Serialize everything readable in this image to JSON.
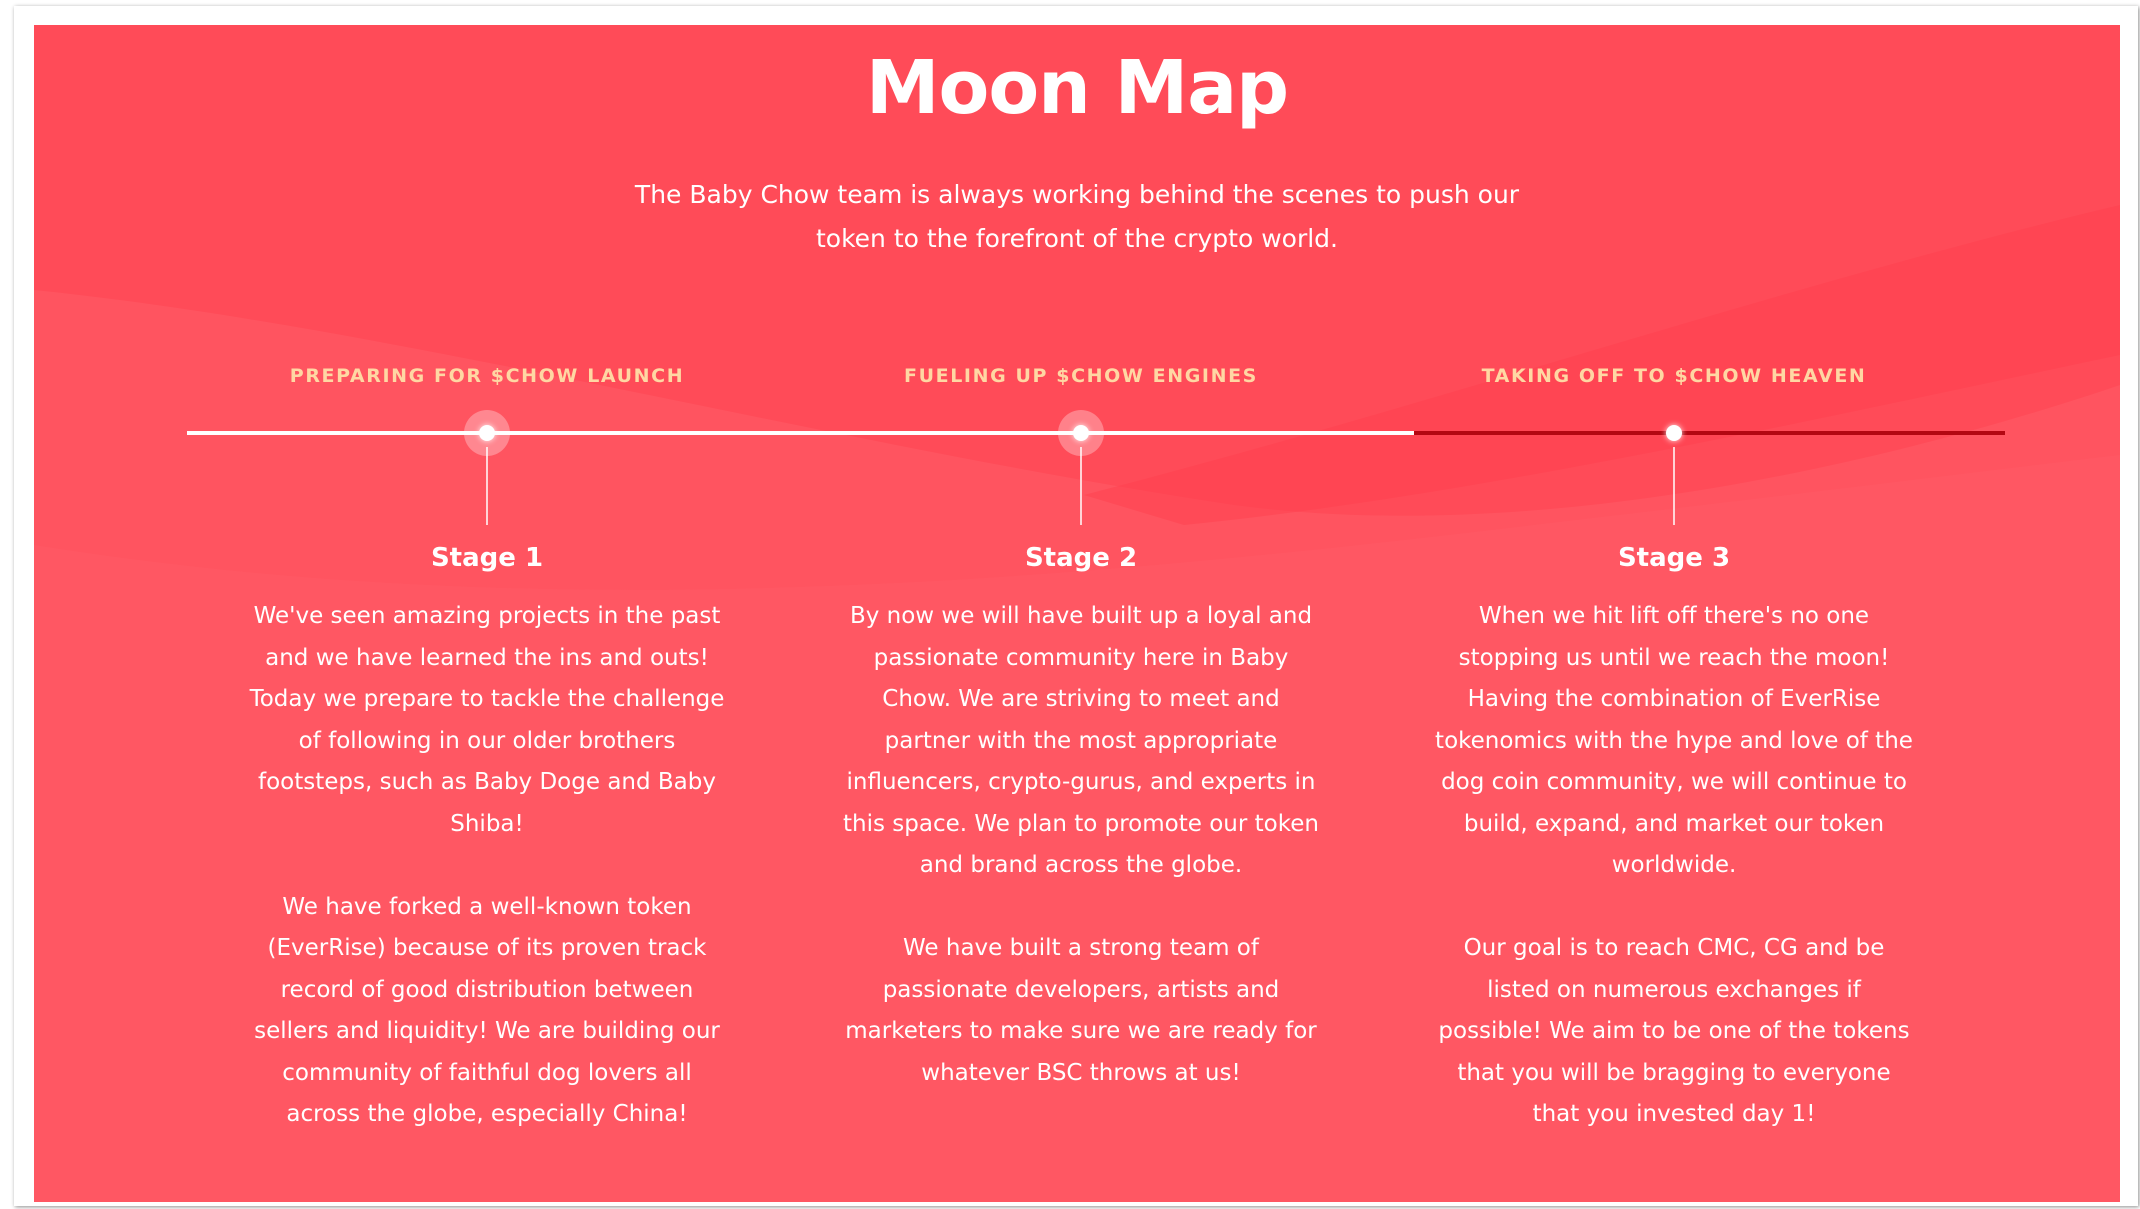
{
  "section": {
    "title": "Moon Map",
    "subtitle": "The Baby Chow team is always working behind the scenes to push our token to the forefront of the crypto world."
  },
  "colors": {
    "background": "#ff4b58",
    "phase_label": "#ffd7a3",
    "timeline_done": "#ffffff",
    "timeline_pending": "#b40712"
  },
  "stages": [
    {
      "phase": "PREPARING FOR $CHOW LAUNCH",
      "title": "Stage 1",
      "paragraphs": [
        "We've seen amazing projects in the past and we have learned the ins and outs! Today we prepare to tackle the challenge of following in our older brothers footsteps, such as Baby Doge and Baby Shiba!",
        "We have forked a well-known token (EverRise) because of its proven track record of good distribution between sellers and liquidity! We are building our community of faithful dog lovers all across the globe, especially China!"
      ]
    },
    {
      "phase": "FUELING UP $CHOW ENGINES",
      "title": "Stage 2",
      "paragraphs": [
        "By now we will have built up a loyal and passionate community here in Baby Chow. We are striving to meet and partner with the most appropriate influencers, crypto-gurus, and experts in this space. We plan to promote our token and brand across the globe.",
        "We have built a strong team of passionate developers, artists and marketers to make sure we are ready for whatever BSC throws at us!"
      ]
    },
    {
      "phase": "TAKING OFF TO $CHOW HEAVEN",
      "title": "Stage 3",
      "paragraphs": [
        "When we hit lift off there's no one stopping us until we reach the moon! Having the combination of EverRise tokenomics with the hype and love of the dog coin community, we will continue to build, expand, and market our token worldwide.",
        "Our goal is to reach CMC, CG and be listed on numerous exchanges if possible! We aim to be one of the tokens that you will be bragging to everyone that you invested day 1!"
      ]
    }
  ]
}
